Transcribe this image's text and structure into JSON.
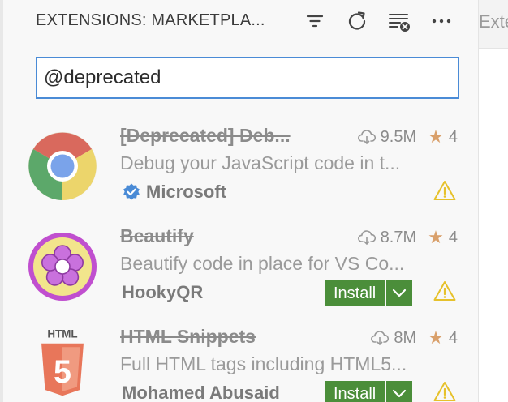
{
  "header": {
    "title": "EXTENSIONS: MARKETPLA...",
    "icons": [
      "filter-icon",
      "refresh-icon",
      "clear-extensions-icon",
      "more-actions-icon"
    ]
  },
  "search": {
    "value": "@deprecated",
    "placeholder": ""
  },
  "extensions": [
    {
      "name": "[Deprecated] Deb...",
      "downloads": "9.5M",
      "rating": "4",
      "description": "Debug your JavaScript code in t...",
      "publisher": "Microsoft",
      "verified": true,
      "icon": "chrome-icon"
    },
    {
      "name": "Beautify",
      "downloads": "8.7M",
      "rating": "4",
      "description": "Beautify code in place for VS Co...",
      "publisher": "HookyQR",
      "install_label": "Install",
      "icon": "beautify-flower-icon"
    },
    {
      "name": "HTML Snippets",
      "downloads": "8M",
      "rating": "4",
      "description": "Full HTML tags including HTML5...",
      "publisher": "Mohamed Abusaid",
      "install_label": "Install",
      "icon": "html5-icon",
      "icon_label": "HTML",
      "icon_glyph": "5"
    }
  ],
  "editor_tab": {
    "label": "Exte"
  },
  "colors": {
    "accent_focus": "#4a8bd6",
    "install_green": "#4b8e3a",
    "star": "#d9a06b",
    "warning": "#e6c12b",
    "verified_blue": "#4a8bd6"
  }
}
